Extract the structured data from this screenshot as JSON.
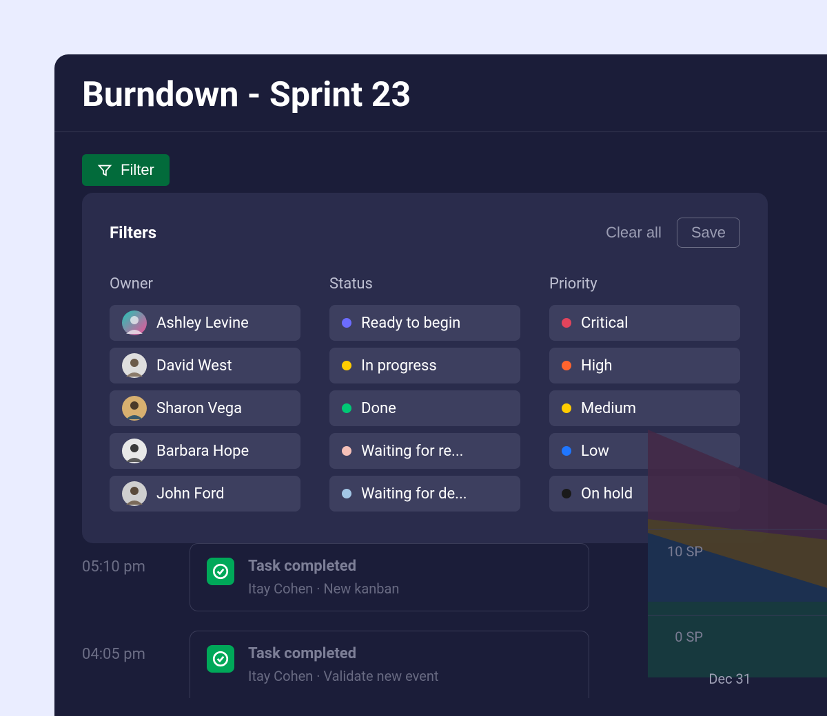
{
  "header": {
    "title": "Burndown - Sprint 23"
  },
  "toolbar": {
    "filter_label": "Filter"
  },
  "filters_panel": {
    "title": "Filters",
    "clear_label": "Clear all",
    "save_label": "Save",
    "columns": {
      "owner": {
        "label": "Owner",
        "items": [
          {
            "label": "Ashley Levine",
            "avatar_bg": "linear-gradient(135deg,#1ec7b6,#f04e98)"
          },
          {
            "label": "David West",
            "avatar_bg": "#dedede"
          },
          {
            "label": "Sharon Vega",
            "avatar_bg": "#d8b070"
          },
          {
            "label": "Barbara Hope",
            "avatar_bg": "#e8e8e8"
          },
          {
            "label": "John Ford",
            "avatar_bg": "#cfcfcf"
          }
        ]
      },
      "status": {
        "label": "Status",
        "items": [
          {
            "label": "Ready to begin",
            "color": "#6c6cff"
          },
          {
            "label": "In progress",
            "color": "#ffcc00"
          },
          {
            "label": "Done",
            "color": "#00c875"
          },
          {
            "label": "Waiting for re...",
            "color": "#f5c0b8"
          },
          {
            "label": "Waiting for de...",
            "color": "#a3c7e6"
          }
        ]
      },
      "priority": {
        "label": "Priority",
        "items": [
          {
            "label": "Critical",
            "color": "#e2445c"
          },
          {
            "label": "High",
            "color": "#ff642e"
          },
          {
            "label": "Medium",
            "color": "#ffcc00"
          },
          {
            "label": "Low",
            "color": "#1f76ff"
          },
          {
            "label": "On hold",
            "color": "#1a1a1a"
          }
        ]
      }
    }
  },
  "activity": [
    {
      "time": "05:10 pm",
      "title": "Task completed",
      "sub": "Itay Cohen · New kanban"
    },
    {
      "time": "04:05 pm",
      "title": "Task completed",
      "sub": "Itay Cohen · Validate new event"
    }
  ],
  "chart_axis": {
    "sp_labels": [
      "10 SP",
      "0 SP"
    ],
    "date_label": "Dec 31"
  }
}
